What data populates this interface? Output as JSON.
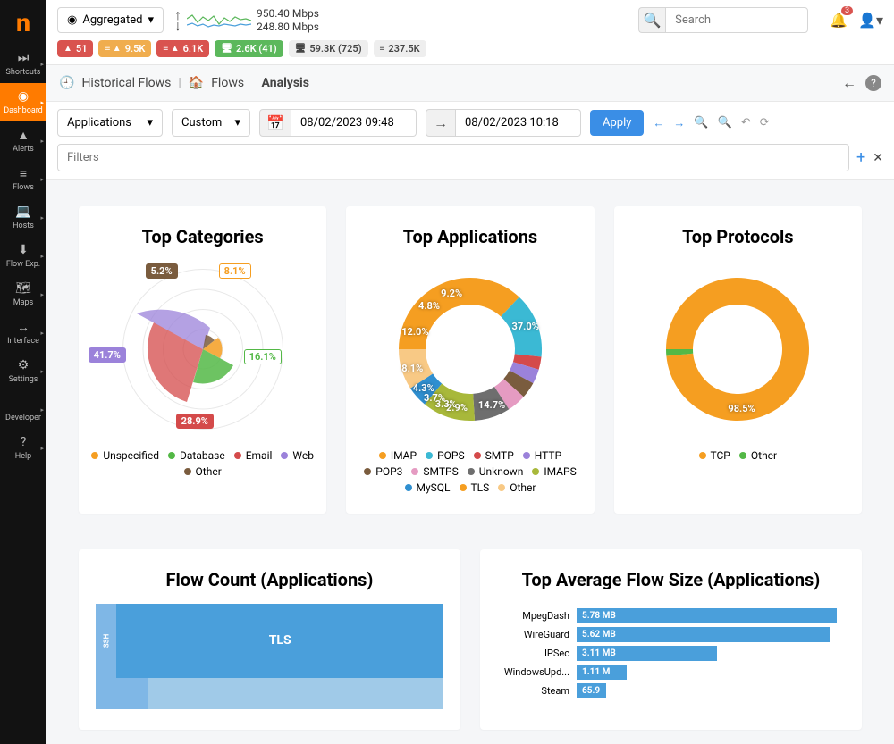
{
  "sidebar": {
    "items": [
      {
        "id": "shortcuts",
        "label": "Shortcuts",
        "icon": "⏭"
      },
      {
        "id": "dashboard",
        "label": "Dashboard",
        "icon": "◉",
        "active": true
      },
      {
        "id": "alerts",
        "label": "Alerts",
        "icon": "▲"
      },
      {
        "id": "flows",
        "label": "Flows",
        "icon": "≡"
      },
      {
        "id": "hosts",
        "label": "Hosts",
        "icon": "💻"
      },
      {
        "id": "flowexp",
        "label": "Flow Exp.",
        "icon": "⬇"
      },
      {
        "id": "maps",
        "label": "Maps",
        "icon": "🗺"
      },
      {
        "id": "interface",
        "label": "Interface",
        "icon": "↔"
      },
      {
        "id": "settings",
        "label": "Settings",
        "icon": "⚙"
      },
      {
        "id": "developer",
        "label": "Developer",
        "icon": "</>"
      },
      {
        "id": "help",
        "label": "Help",
        "icon": "?"
      }
    ]
  },
  "topbar": {
    "aggregated": "Aggregated",
    "traffic_up": "950.40 Mbps",
    "traffic_down": "248.80 Mbps",
    "search_placeholder": "Search",
    "bell_count": "3"
  },
  "status_pills": [
    {
      "text": "51",
      "icon": "▲",
      "cls": "p-red"
    },
    {
      "text": "9.5K",
      "icon": "≡ ▲",
      "cls": "p-orange"
    },
    {
      "text": "6.1K",
      "icon": "≡ ▲",
      "cls": "p-red"
    },
    {
      "text": "2.6K (41)",
      "icon": "🖥",
      "cls": "p-green"
    },
    {
      "text": "59.3K (725)",
      "icon": "🖥",
      "cls": "p-grey"
    },
    {
      "text": "237.5K",
      "icon": "≡",
      "cls": "p-grey"
    }
  ],
  "breadcrumb": {
    "root": "Historical Flows",
    "mid": "Flows",
    "leaf": "Analysis"
  },
  "filters": {
    "dim": "Applications",
    "range": "Custom",
    "from": "08/02/2023 09:48",
    "to": "08/02/2023 10:18",
    "apply": "Apply",
    "filters_ph": "Filters"
  },
  "chart_data": [
    {
      "title": "Top Categories",
      "type": "pie",
      "series": [
        {
          "name": "Unspecified",
          "value": 8.1,
          "color": "#f59e21"
        },
        {
          "name": "Database",
          "value": 16.1,
          "color": "#53b846"
        },
        {
          "name": "Email",
          "value": 28.9,
          "color": "#d44a4a"
        },
        {
          "name": "Web",
          "value": 41.7,
          "color": "#9b82da"
        },
        {
          "name": "Other",
          "value": 5.2,
          "color": "#7a5c3e"
        }
      ]
    },
    {
      "title": "Top Applications",
      "type": "pie",
      "series": [
        {
          "name": "IMAP",
          "value": 37.0,
          "color": "#f59e21"
        },
        {
          "name": "POPS",
          "value": 14.7,
          "color": "#3bb9d4"
        },
        {
          "name": "SMTP",
          "value": 2.9,
          "color": "#d44a4a"
        },
        {
          "name": "HTTP",
          "value": 3.3,
          "color": "#9b82da"
        },
        {
          "name": "POP3",
          "value": 3.7,
          "color": "#7a5c3e"
        },
        {
          "name": "SMTPS",
          "value": 4.3,
          "color": "#e59bc2"
        },
        {
          "name": "Unknown",
          "value": 8.1,
          "color": "#6e6e6e"
        },
        {
          "name": "IMAPS",
          "value": 12.0,
          "color": "#a8b83a"
        },
        {
          "name": "MySQL",
          "value": 4.8,
          "color": "#2f8fd0"
        },
        {
          "name": "TLS",
          "value": 0,
          "color": "#f59e21"
        },
        {
          "name": "Other",
          "value": 9.2,
          "color": "#f8c985"
        }
      ]
    },
    {
      "title": "Top Protocols",
      "type": "pie",
      "series": [
        {
          "name": "TCP",
          "value": 98.5,
          "color": "#f59e21"
        },
        {
          "name": "Other",
          "value": 1.5,
          "color": "#53b846"
        }
      ]
    },
    {
      "title": "Flow Count (Applications)",
      "type": "area",
      "series": [
        {
          "name": "TLS",
          "value": 70
        },
        {
          "name": "SSH",
          "value": 5
        }
      ]
    },
    {
      "title": "Top Average Flow Size (Applications)",
      "type": "bar",
      "xlabel": "",
      "ylabel": "",
      "series": [
        {
          "name": "MpegDash",
          "value": 5.78,
          "label": "5.78 MB"
        },
        {
          "name": "WireGuard",
          "value": 5.62,
          "label": "5.62 MB"
        },
        {
          "name": "IPSec",
          "value": 3.11,
          "label": "3.11 MB"
        },
        {
          "name": "WindowsUpd...",
          "value": 1.11,
          "label": "1.11 M"
        },
        {
          "name": "Steam",
          "value": 0.659,
          "label": "65.9"
        }
      ]
    }
  ]
}
